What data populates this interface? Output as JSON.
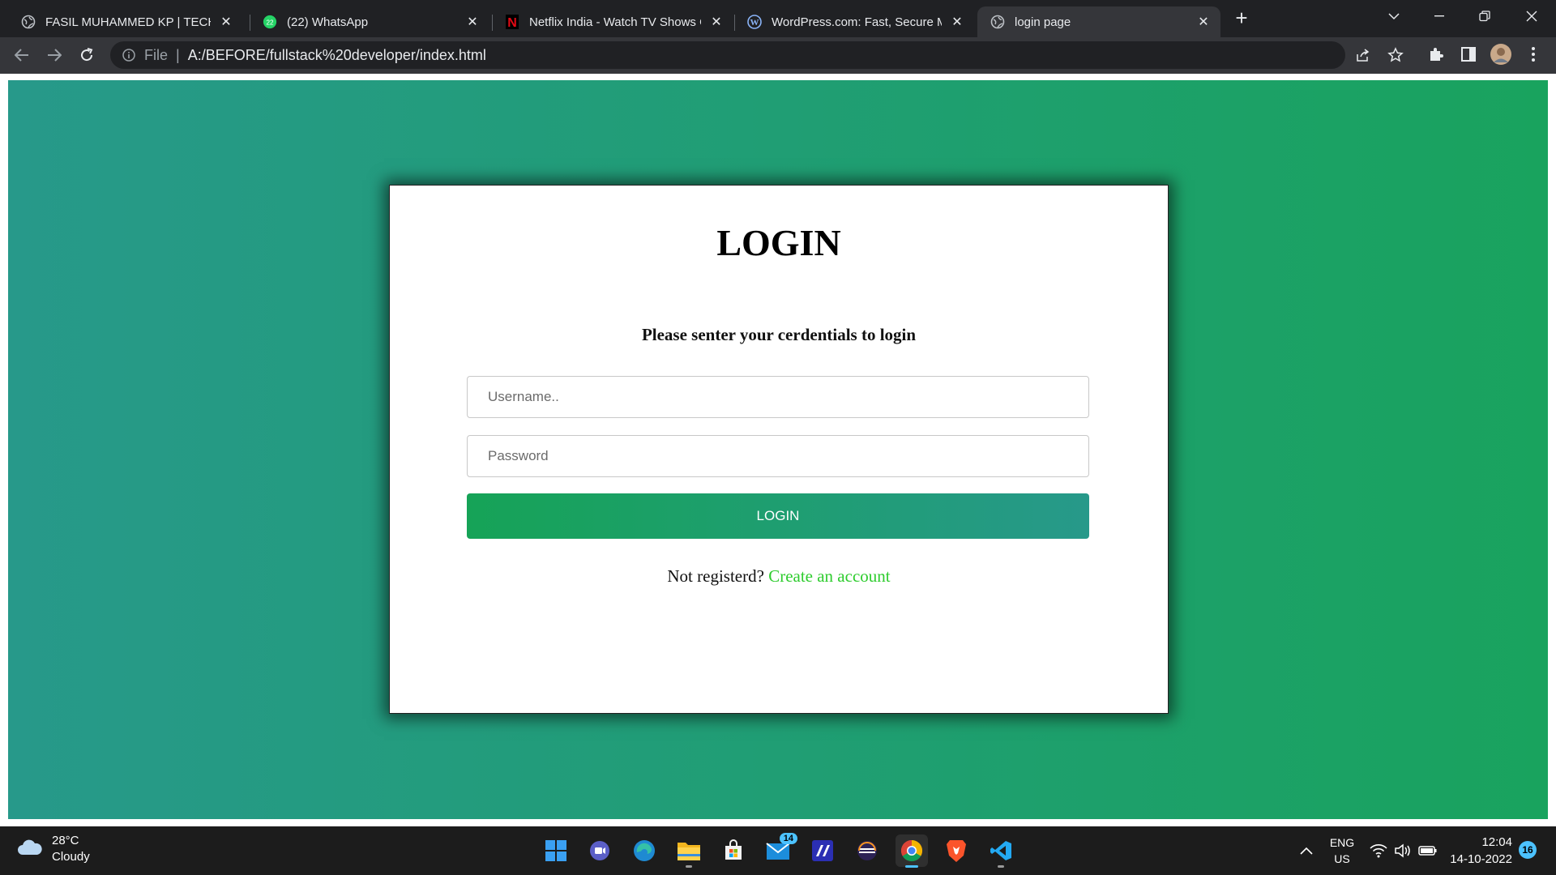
{
  "browser": {
    "tabs": [
      {
        "title": "FASIL MUHAMMED KP | TECH EN",
        "icon": "globe-icon",
        "active": false
      },
      {
        "title": "(22) WhatsApp",
        "icon": "whatsapp-icon",
        "badge": "22",
        "active": false
      },
      {
        "title": "Netflix India - Watch TV Shows O",
        "icon": "netflix-icon",
        "active": false
      },
      {
        "title": "WordPress.com: Fast, Secure Man",
        "icon": "wordpress-icon",
        "active": false
      },
      {
        "title": "login page",
        "icon": "globe-icon",
        "active": true
      }
    ],
    "address": {
      "scheme": "File",
      "url": "A:/BEFORE/fullstack%20developer/index.html"
    }
  },
  "page": {
    "heading": "LOGIN",
    "subtitle": "Please senter your cerdentials to login",
    "username_placeholder": "Username..",
    "password_placeholder": "Password",
    "login_button": "LOGIN",
    "register_prompt": "Not registerd?",
    "register_link": "Create an account",
    "colors": {
      "gradient_start": "#27998a",
      "gradient_end": "#19a35e",
      "link": "#2ecc2e"
    }
  },
  "taskbar": {
    "weather": {
      "temp": "28°C",
      "condition": "Cloudy"
    },
    "apps": [
      {
        "name": "start-icon"
      },
      {
        "name": "teams-chat-icon"
      },
      {
        "name": "edge-icon"
      },
      {
        "name": "file-explorer-icon"
      },
      {
        "name": "microsoft-store-icon"
      },
      {
        "name": "mail-icon",
        "badge": "14"
      },
      {
        "name": "vscode-insiders-icon"
      },
      {
        "name": "eclipse-icon"
      },
      {
        "name": "chrome-icon",
        "active": true
      },
      {
        "name": "brave-icon"
      },
      {
        "name": "vscode-icon"
      }
    ],
    "language": {
      "line1": "ENG",
      "line2": "US"
    },
    "time": "12:04",
    "date": "14-10-2022",
    "notifications": "16"
  }
}
